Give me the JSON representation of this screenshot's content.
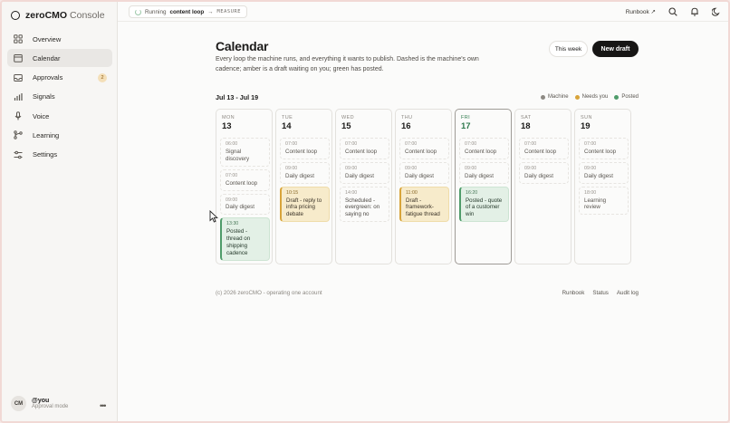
{
  "app": {
    "brand_bold": "zeroCMO",
    "brand_light": "Console"
  },
  "sidebar": {
    "items": [
      {
        "label": "Overview",
        "icon": "grid-icon"
      },
      {
        "label": "Calendar",
        "icon": "calendar-icon",
        "active": true
      },
      {
        "label": "Approvals",
        "icon": "inbox-icon",
        "badge": "2"
      },
      {
        "label": "Signals",
        "icon": "bar-chart-icon"
      },
      {
        "label": "Voice",
        "icon": "microphone-icon"
      },
      {
        "label": "Learning",
        "icon": "branch-icon"
      },
      {
        "label": "Settings",
        "icon": "sliders-icon"
      }
    ],
    "user": {
      "initials": "CM",
      "name": "@you",
      "role": "Approval mode"
    }
  },
  "topbar": {
    "status_prefix": "Running",
    "status_name": "content loop",
    "status_sep": "→",
    "status_phase": "MEASURE",
    "runbook_label": "Runbook ↗"
  },
  "page": {
    "title": "Calendar",
    "description": "Every loop the machine runs, and everything it wants to publish. Dashed is the machine's own cadence; amber is a draft waiting on you; green has posted.",
    "this_week_label": "This week",
    "new_draft_label": "New draft",
    "range_label": "Jul 13 - Jul 19",
    "legend": [
      {
        "label": "Machine",
        "color": "#8d8983"
      },
      {
        "label": "Needs you",
        "color": "#d8a43a"
      },
      {
        "label": "Posted",
        "color": "#4f9c6a"
      }
    ]
  },
  "days": [
    {
      "name": "MON",
      "num": "13",
      "events": [
        {
          "time": "06:00",
          "label": "Signal discovery",
          "kind": "machine"
        },
        {
          "time": "07:00",
          "label": "Content loop",
          "kind": "machine"
        },
        {
          "time": "09:00",
          "label": "Daily digest",
          "kind": "machine"
        },
        {
          "time": "13:30",
          "label": "Posted - thread on shipping cadence",
          "kind": "posted"
        }
      ]
    },
    {
      "name": "TUE",
      "num": "14",
      "events": [
        {
          "time": "07:00",
          "label": "Content loop",
          "kind": "machine"
        },
        {
          "time": "09:00",
          "label": "Daily digest",
          "kind": "machine"
        },
        {
          "time": "10:15",
          "label": "Draft - reply to infra pricing debate",
          "kind": "draft"
        }
      ]
    },
    {
      "name": "WED",
      "num": "15",
      "events": [
        {
          "time": "07:00",
          "label": "Content loop",
          "kind": "machine"
        },
        {
          "time": "09:00",
          "label": "Daily digest",
          "kind": "machine"
        },
        {
          "time": "14:00",
          "label": "Scheduled - evergreen: on saying no",
          "kind": "scheduled"
        }
      ]
    },
    {
      "name": "THU",
      "num": "16",
      "events": [
        {
          "time": "07:00",
          "label": "Content loop",
          "kind": "machine"
        },
        {
          "time": "09:00",
          "label": "Daily digest",
          "kind": "machine"
        },
        {
          "time": "11:00",
          "label": "Draft - framework-fatigue thread",
          "kind": "draft"
        }
      ]
    },
    {
      "name": "FRI",
      "num": "17",
      "today": true,
      "events": [
        {
          "time": "07:00",
          "label": "Content loop",
          "kind": "machine"
        },
        {
          "time": "09:00",
          "label": "Daily digest",
          "kind": "machine"
        },
        {
          "time": "16:20",
          "label": "Posted - quote of a customer win",
          "kind": "posted"
        }
      ]
    },
    {
      "name": "SAT",
      "num": "18",
      "events": [
        {
          "time": "07:00",
          "label": "Content loop",
          "kind": "machine"
        },
        {
          "time": "09:00",
          "label": "Daily digest",
          "kind": "machine"
        }
      ]
    },
    {
      "name": "SUN",
      "num": "19",
      "events": [
        {
          "time": "07:00",
          "label": "Content loop",
          "kind": "machine"
        },
        {
          "time": "09:00",
          "label": "Daily digest",
          "kind": "machine"
        },
        {
          "time": "18:00",
          "label": "Learning review",
          "kind": "machine"
        }
      ]
    }
  ],
  "footer": {
    "copyright": "(c) 2026 zeroCMO - operating one account",
    "links": [
      "Runbook",
      "Status",
      "Audit log"
    ]
  }
}
